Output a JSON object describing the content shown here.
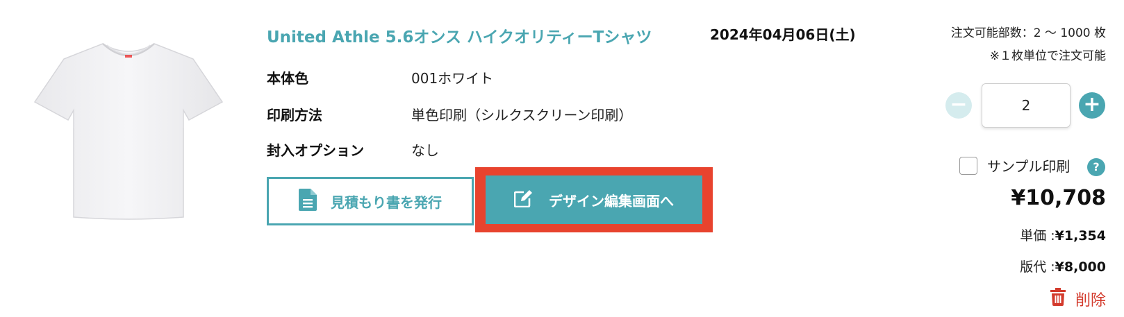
{
  "product": {
    "title": "United Athle 5.6オンス ハイクオリティーTシャツ",
    "delivery_date": "2024年04月06日(土)",
    "specs": [
      {
        "label": "本体色",
        "value": "001ホワイト"
      },
      {
        "label": "印刷方法",
        "value": "単色印刷（シルクスクリーン印刷）"
      },
      {
        "label": "封入オプション",
        "value": "なし"
      }
    ]
  },
  "actions": {
    "estimate_label": "見積もり書を発行",
    "design_label": "デザイン編集画面へ"
  },
  "order": {
    "range_text": "注文可能部数：2 〜 1000 枚",
    "unit_note": "※１枚単位で注文可能",
    "quantity": "2",
    "sample_label": "サンプル印刷",
    "help_symbol": "?",
    "total_price": "¥10,708",
    "unit_price_label": "単価 :",
    "unit_price_value": "¥1,354",
    "plate_fee_label": "版代 :",
    "plate_fee_value": "¥8,000",
    "delete_label": "削除"
  },
  "colors": {
    "accent": "#4aa6b1",
    "highlight": "#e8432e",
    "danger": "#d33a2c"
  },
  "icons": [
    "tshirt-image",
    "document-icon",
    "edit-icon",
    "minus-icon",
    "plus-icon",
    "help-icon",
    "trash-icon"
  ]
}
